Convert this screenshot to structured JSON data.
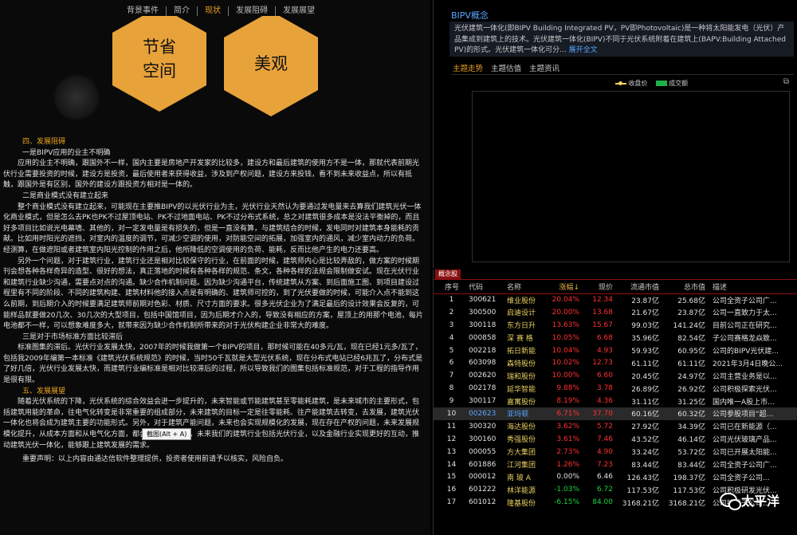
{
  "left_tabs": [
    "背景事件",
    "简介",
    "现状",
    "发展阻碍",
    "发展展望"
  ],
  "hero": {
    "hex1": [
      "节省",
      "空间"
    ],
    "hex2": [
      "美观"
    ]
  },
  "article": {
    "h4": "四、发展阻碍",
    "s1": "一是BIPV应用的业主不明确",
    "p1": "应用的业主不明确，跟国外不一样，国内主要是房地产开发家的比较多，建设方和最后建筑的使用方不是一体，那就代表前期光伏行业需要投资的时候，建设方是投资，最后使用者来获得收益，涉及到产权问题，建设方来投钱，看不到未来收益点，所以有抵触，跟国外是有区别，国外的建设方跟投资方相对是一体的。",
    "s2": "二是商业模式没有建立起来",
    "p2": "整个商业模式没有建立起来，可能现在主要推BIPV的以光伏行业为主，光伏行业天然认为要通过发电量来去算我们建筑光伏一体化商业模式，但是怎么去PK也PK不过屋顶电站、PK不过地面电站、PK不过分布式系统，总之对建筑很多成本是没法平衡掉的，而且好多项目比如说光电幕墙、其他的，对一定发电量是有损失的，但是一直没有算，与建筑结合的时候，发电同时对建筑本身能耗的贡献。比如用时阳光的遮挡，对室内的温度的调节，可减少空调的使用，对防能空间的拓展，加强室内的通风，减少室内动力的负荷。经测算，在做遮阳或者建筑室内阳光控制的作用之后，他所降低的空调使用的负荷、能耗，反而比他产生的电力还要高。",
    "p3": "另外一个问题，对于建筑行业，建筑行业还是相对比较保守的行业，在前面的时候，建筑师内心是比较弄敌的，做方案的时候期刊会想各种各样奇异的造型、很好的想法，真正落地的时候有各种各样的规范、条文，各种各样的法规会限制做安试。现在光伏行业和建筑行业缺少沟通，需要点对点的沟通。缺少合作机制问题。因为缺少沟通平台，传统建筑从方案、到后面施工图、到项目建设过程里有不同的阶段、不同的建筑构建、建筑材料他的接入点是有明确的、建筑师可控的，到了光伏要做的时候，可能介入点不能到这么前期，到后期介入的时候要满足建筑师前期对色彩、材质、尺寸方面的要求。很多光伏企业为了满足最后的设计效果会反复的，可能样品就要做20几次、30几次的大型项目，包括中国馆项目，因为后期才介入的，导致没有相应的方案，屋顶上的用那个电池，每片电池都不一样，可以想象难度多大，就带来因为缺少合作机制所带来的对于光伏构建企业非常大的难度。",
    "s3": "三是对于市场标准方面比较滞后",
    "p4": "标准图集的滞后。光伏行业发展太快，2007年的时候我做第一个BIPV的项目，那时候可能在40多元/瓦，现在已经1元多/瓦了，包括我2009年编第一本标准《建筑光伏系统规范》的时候，当时50千瓦就是大型光伏系统，现在分布式电站已经6兆瓦了，分布式是了好几倍，光伏行业发展太快，而建筑行业编标准是相对比较滞后的过程，所以导致我们的图集包括标准规范，对于工程的指导作用是很有限。",
    "h5": "五、发展展望",
    "p5": "随着光伏系统的下降，光伏系统的综合效益会进一步提升的，未来智能或节能建筑甚至零能耗建筑，是未来城市的主要形式，包括建筑用能的革命，往电气化转变是非常重要的组成部分，未来建筑的目标一定是往零能耗、往产能建筑去转变，去发展，建筑光伏一体化也将会成为建筑主要的功能形式。另外，对于建筑产能问题，未来也会实现规模化的发展，现在存在产权的问题，未来发展规模化提升，从成本方面和从电气化方面，都会有转变。同时，未来我们的建筑行业包括光伏行业，以及金融行业实现更好的互动，推动建筑光伏一体化，能够跟上建筑发展的需求。",
    "disclaimer": "重要声明：以上内容由通达信软件整理提供，投资者使用前请予以核实，风险自负。",
    "tooltip": "截图(Alt + A)"
  },
  "concept": {
    "title": "BIPV概念",
    "desc": "光伏建筑一体化(即BIPV Building Integrated PV，PV即Photovoltaic)是一种将太阳能发电（光伏）产品集成到建筑上的技术。光伏建筑一体化(BIPV)不同于光伏系统附着在建筑上(BAPV:Building Attached PV)的形式。光伏建筑一体化可分...",
    "more": "展开全文"
  },
  "chart_tabs": [
    "主题走势",
    "主题估值",
    "主题资讯"
  ],
  "legend": {
    "close": "收盘价",
    "volume": "成交额"
  },
  "corner_icon": "restore-icon",
  "board_tab": "概念股",
  "table": {
    "headers": [
      "序号",
      "代码",
      "名称",
      "涨幅↓",
      "现价",
      "流通市值",
      "总市值",
      "描述"
    ],
    "rows": [
      [
        "1",
        "300621",
        "维业股份",
        "20.04%",
        "12.34",
        "23.87亿",
        "25.68亿",
        "公司全资子公司广..."
      ],
      [
        "2",
        "300500",
        "启迪设计",
        "20.00%",
        "13.68",
        "21.67亿",
        "23.87亿",
        "公司一直致力于太..."
      ],
      [
        "3",
        "300118",
        "东方日升",
        "13.63%",
        "15.67",
        "99.03亿",
        "141.24亿",
        "目前公司正在研究..."
      ],
      [
        "4",
        "000858",
        "深 赛 格",
        "10.05%",
        "6.68",
        "35.96亿",
        "82.54亿",
        "子公司赛格龙焱致..."
      ],
      [
        "5",
        "002218",
        "拓日新能",
        "10.04%",
        "4.93",
        "59.93亿",
        "60.95亿",
        "公司的BIPV光伏建..."
      ],
      [
        "6",
        "603098",
        "森特股份",
        "10.02%",
        "12.73",
        "61.11亿",
        "61.11亿",
        "2021年3月4日晚公..."
      ],
      [
        "7",
        "002620",
        "瑞和股份",
        "10.00%",
        "6.60",
        "20.45亿",
        "24.97亿",
        "公司主营业务是以..."
      ],
      [
        "8",
        "002178",
        "延华智能",
        "9.88%",
        "3.78",
        "26.89亿",
        "26.92亿",
        "公司积极探索光伏..."
      ],
      [
        "9",
        "300117",
        "嘉寓股份",
        "8.19%",
        "4.36",
        "31.11亿",
        "31.25亿",
        "国内唯一A股上市..."
      ],
      [
        "10",
        "002623",
        "亚玛顿",
        "6.71%",
        "37.70",
        "60.16亿",
        "60.32亿",
        "公司参股项目“超..."
      ],
      [
        "11",
        "300320",
        "海达股份",
        "3.62%",
        "5.72",
        "27.92亿",
        "34.39亿",
        "公司已在新能源（..."
      ],
      [
        "12",
        "300160",
        "秀强股份",
        "3.61%",
        "7.46",
        "43.52亿",
        "46.14亿",
        "公司光伏玻璃产品..."
      ],
      [
        "13",
        "000055",
        "方大集团",
        "2.73%",
        "4.90",
        "33.24亿",
        "53.72亿",
        "公司已开展太阳能..."
      ],
      [
        "14",
        "601886",
        "江河集团",
        "1.26%",
        "7.23",
        "83.44亿",
        "83.44亿",
        "公司全资子公司广..."
      ],
      [
        "15",
        "000012",
        "南 玻 A",
        "0.00%",
        "6.46",
        "126.43亿",
        "198.37亿",
        "公司全资子公司..."
      ],
      [
        "16",
        "601222",
        "林洋能源",
        "-1.03%",
        "6.72",
        "117.53亿",
        "117.53亿",
        "公司积极研发光伏..."
      ],
      [
        "17",
        "601012",
        "隆基股份",
        "-6.15%",
        "84.00",
        "3168.21亿",
        "3168.21亿",
        "公司控股子公司..."
      ]
    ]
  },
  "watermark": "太平洋",
  "colors": {
    "accent": "#e8a020",
    "up": "#ff3030",
    "down": "#20d040",
    "link": "#5aa6ff",
    "hex": "#e8a23a"
  }
}
